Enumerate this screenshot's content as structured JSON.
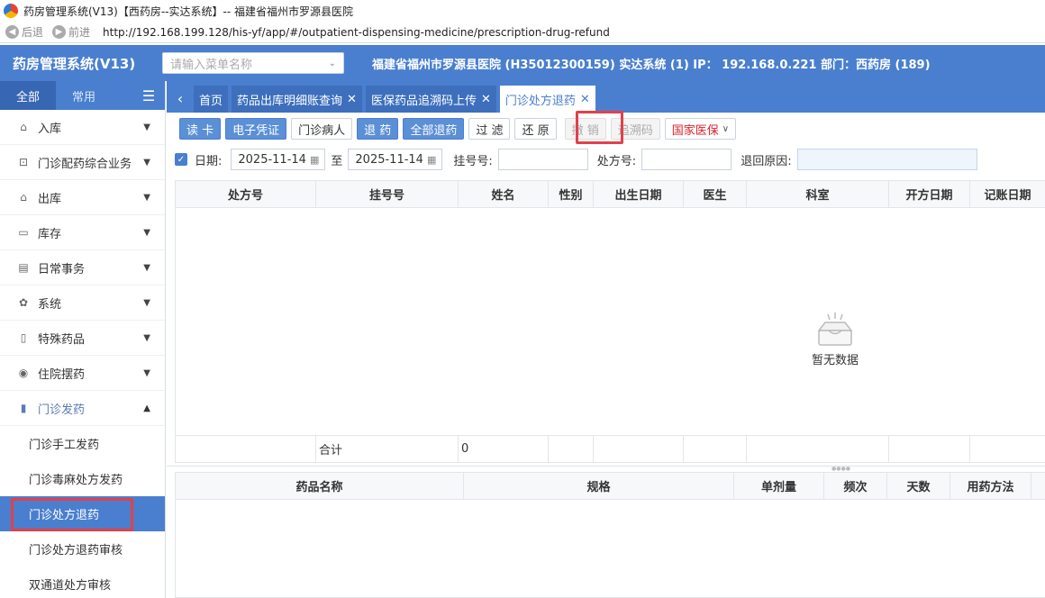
{
  "window": {
    "title": "药房管理系统(V13)【西药房--实达系统】-- 福建省福州市罗源县医院"
  },
  "browser": {
    "back_label": "后退",
    "forward_label": "前进",
    "url": "http://192.168.199.128/his-yf/app/#/outpatient-dispensing-medicine/prescription-drug-refund"
  },
  "header": {
    "app_title": "药房管理系统(V13)",
    "menu_search_placeholder": "请输入菜单名称",
    "hospital_info": "福建省福州市罗源县医院 (H35012300159) 实达系统 (1) IP： 192.168.0.221 部门：西药房 (189)"
  },
  "sidebar": {
    "tabs": [
      "全部",
      "常用"
    ],
    "items": [
      {
        "label": "入库",
        "icon": "warehouse-icon"
      },
      {
        "label": "门诊配药综合业务",
        "icon": "bag-icon"
      },
      {
        "label": "出库",
        "icon": "outbound-icon"
      },
      {
        "label": "库存",
        "icon": "stock-chart-icon"
      },
      {
        "label": "日常事务",
        "icon": "document-icon"
      },
      {
        "label": "系统",
        "icon": "gear-icon"
      },
      {
        "label": "特殊药品",
        "icon": "medicine-bottle-icon"
      },
      {
        "label": "住院摆药",
        "icon": "target-icon"
      },
      {
        "label": "门诊发药",
        "icon": "pharmacy-icon"
      }
    ],
    "subitems": [
      "门诊手工发药",
      "门诊毒麻处方发药",
      "门诊处方退药",
      "门诊处方退药审核",
      "双通道处方审核"
    ]
  },
  "tabs": [
    {
      "label": "首页"
    },
    {
      "label": "药品出库明细账查询"
    },
    {
      "label": "医保药品追溯码上传"
    },
    {
      "label": "门诊处方退药"
    }
  ],
  "toolbar": {
    "read_card": "读 卡",
    "e_voucher": "电子凭证",
    "outpatient": "门诊病人",
    "refund": "退 药",
    "refund_all": "全部退药",
    "filter": "过 滤",
    "restore": "还 原",
    "cancel": "撤 销",
    "trace_code": "追溯码",
    "national_insurance": "国家医保"
  },
  "filter": {
    "date_label": "日期:",
    "date_from": "2025-11-14",
    "to_label": "至",
    "date_to": "2025-11-14",
    "reg_label": "挂号号:",
    "presc_label": "处方号:",
    "reason_label": "退回原因:"
  },
  "grid_top": {
    "columns": [
      "处方号",
      "挂号号",
      "姓名",
      "性别",
      "出生日期",
      "医生",
      "科室",
      "开方日期",
      "记账日期"
    ],
    "empty_text": "暂无数据",
    "footer_label": "合计",
    "footer_value": "0"
  },
  "grid_bottom": {
    "columns": [
      "药品名称",
      "规格",
      "单剂量",
      "频次",
      "天数",
      "用药方法"
    ]
  },
  "colors": {
    "primary": "#4a7fcf",
    "highlight": "#e0414b"
  }
}
